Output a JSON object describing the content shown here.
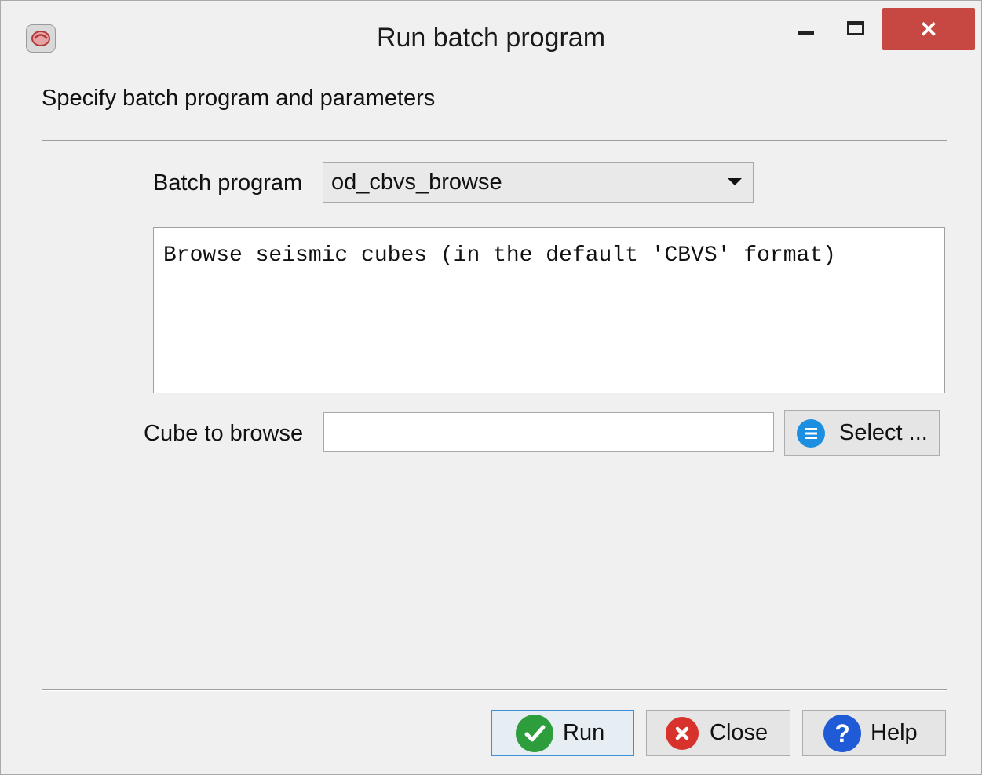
{
  "window": {
    "title": "Run batch program",
    "close_glyph": "✕"
  },
  "header": {
    "text": "Specify batch program and parameters"
  },
  "batch_program": {
    "label": "Batch program",
    "selected": "od_cbvs_browse"
  },
  "description": {
    "text": "Browse seismic cubes (in the default 'CBVS' format)"
  },
  "cube": {
    "label": "Cube to browse",
    "value": "",
    "select_label": "Select ..."
  },
  "buttons": {
    "run": "Run",
    "close": "Close",
    "help": "Help"
  },
  "colors": {
    "close_window": "#c74743",
    "run_icon": "#2e9d3c",
    "close_icon": "#d7332c",
    "help_icon": "#1f5bd6",
    "select_icon": "#1c8fe0"
  },
  "icons": {
    "app": "opendtect-app-icon",
    "select": "list-icon",
    "run": "checkmark-icon",
    "close": "close-circle-icon",
    "help": "help-icon"
  }
}
